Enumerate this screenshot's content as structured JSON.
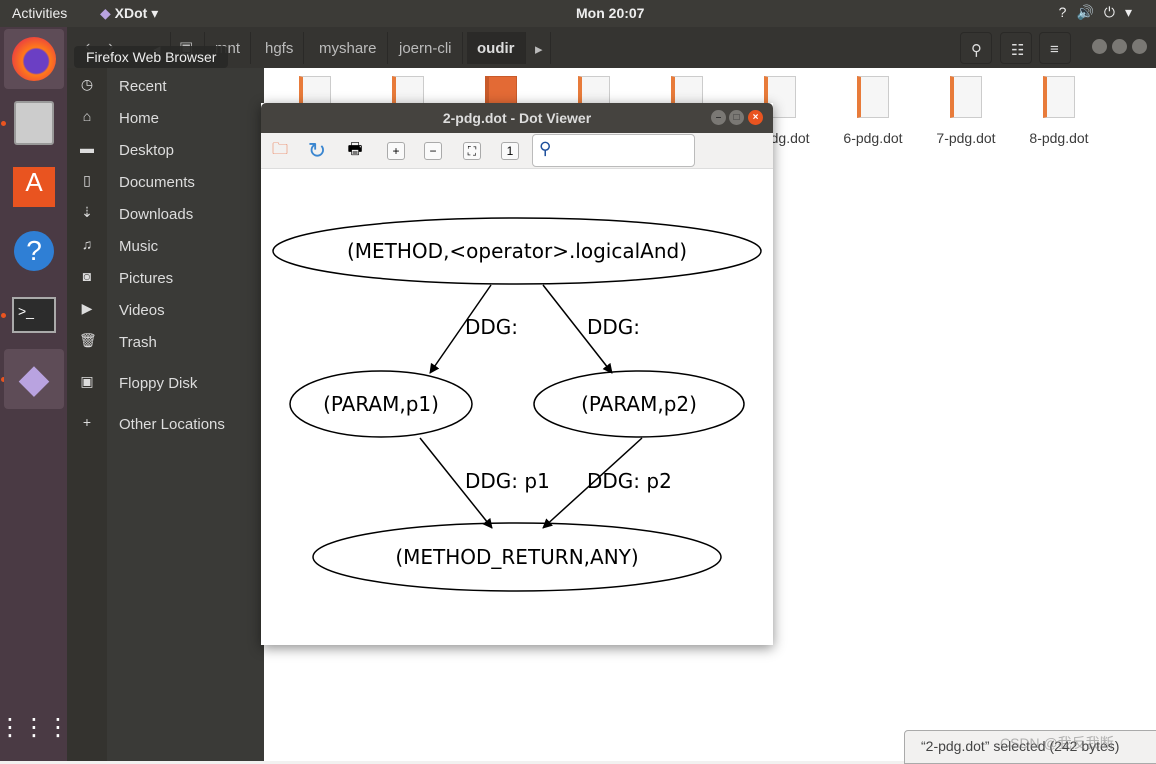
{
  "topbar": {
    "activities": "Activities",
    "app_name": "XDot",
    "clock": "Mon 20:07",
    "tray_icons": [
      "network-unknown-icon",
      "volume-icon",
      "power-icon",
      "chevron-down-icon"
    ]
  },
  "dock": {
    "items": [
      "firefox",
      "files",
      "software",
      "help",
      "terminal",
      "xdot",
      "app-grid"
    ],
    "tooltip": "Firefox Web Browser"
  },
  "filemanager": {
    "breadcrumb": [
      "mnt",
      "hgfs",
      "myshare",
      "joern-cli",
      "oudir"
    ],
    "sidebar": [
      {
        "label": "Recent",
        "icon": "clock-icon"
      },
      {
        "label": "Home",
        "icon": "home-icon"
      },
      {
        "label": "Desktop",
        "icon": "folder-icon"
      },
      {
        "label": "Documents",
        "icon": "document-icon"
      },
      {
        "label": "Downloads",
        "icon": "download-icon"
      },
      {
        "label": "Music",
        "icon": "music-icon"
      },
      {
        "label": "Pictures",
        "icon": "camera-icon"
      },
      {
        "label": "Videos",
        "icon": "video-icon"
      },
      {
        "label": "Trash",
        "icon": "trash-icon"
      },
      {
        "label": "Floppy Disk",
        "icon": "floppy-icon"
      },
      {
        "label": "Other Locations",
        "icon": "plus-icon"
      }
    ],
    "files": [
      "",
      "",
      "",
      "",
      "",
      "5-pdg.dot",
      "6-pdg.dot",
      "7-pdg.dot",
      "8-pdg.dot"
    ],
    "status": "“2-pdg.dot” selected (242 bytes)",
    "watermark": "CSDN @我反我断"
  },
  "viewer": {
    "title": "2-pdg.dot - Dot Viewer",
    "search_value": "",
    "graph": {
      "nodes": {
        "method": "(METHOD,<operator>.logicalAnd)",
        "p1": "(PARAM,p1)",
        "p2": "(PARAM,p2)",
        "ret": "(METHOD_RETURN,ANY)"
      },
      "edges": [
        {
          "from": "method",
          "to": "p1",
          "label": "DDG: "
        },
        {
          "from": "method",
          "to": "p2",
          "label": "DDG: "
        },
        {
          "from": "p1",
          "to": "ret",
          "label": "DDG: p1"
        },
        {
          "from": "p2",
          "to": "ret",
          "label": "DDG: p2"
        }
      ]
    }
  }
}
